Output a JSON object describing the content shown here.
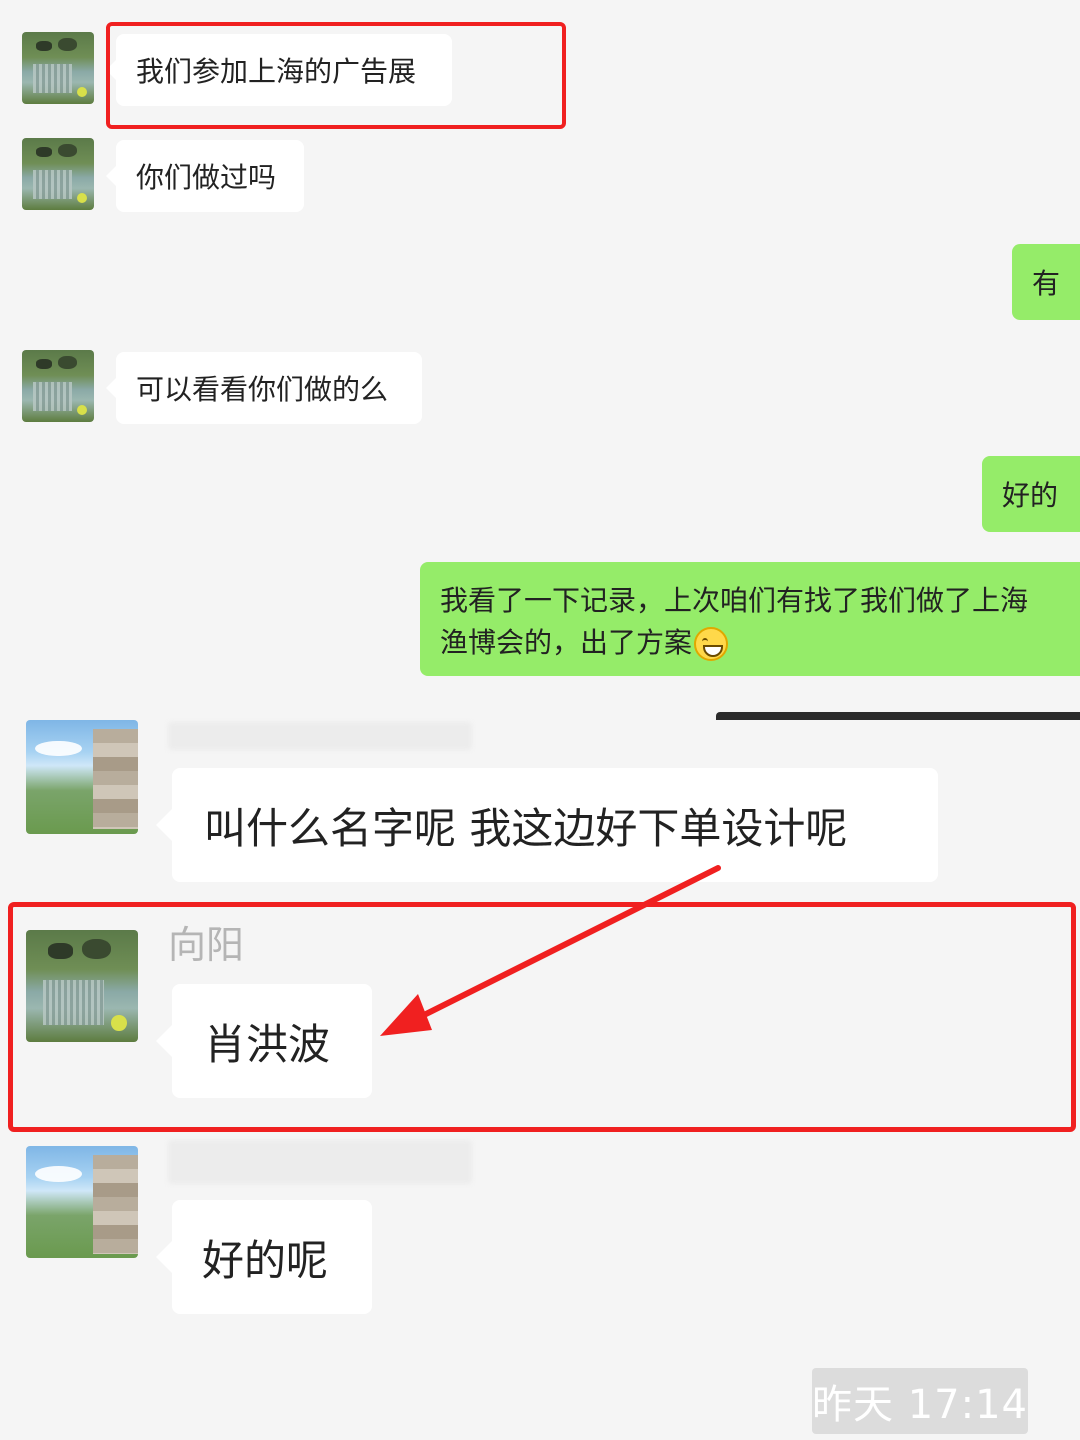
{
  "messages": [
    {
      "text": "我们参加上海的广告展"
    },
    {
      "text": "你们做过吗"
    },
    {
      "text": "有"
    },
    {
      "text": "可以看看你们做的么"
    },
    {
      "text": "好的"
    },
    {
      "text_line1": "我看了一下记录，上次咱们有找了我们做了上海",
      "text_line2": "渔博会的，出了方案"
    },
    {
      "text": "叫什么名字呢 我这边好下单设计呢"
    },
    {
      "sender": "向阳",
      "text": "肖洪波"
    },
    {
      "text": "好的呢"
    }
  ],
  "emoji": "grinning-face-emoji",
  "timestamp": "昨天 17:14",
  "colors": {
    "background": "#f5f5f5",
    "incoming_bubble": "#ffffff",
    "outgoing_bubble": "#95ec69",
    "highlight": "#f02020"
  }
}
